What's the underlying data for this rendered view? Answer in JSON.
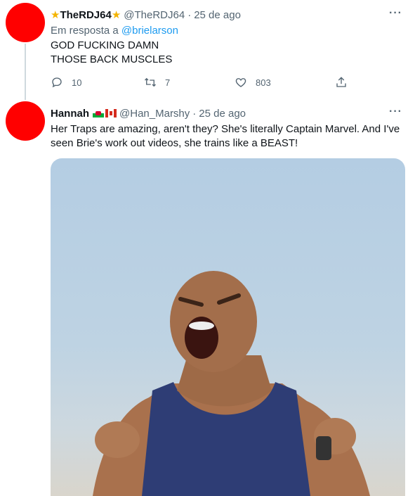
{
  "tweets": [
    {
      "name": "TheRDJ64",
      "handle": "@TheRDJ64",
      "separator": "·",
      "date": "25 de ago",
      "reply_prefix": "Em resposta a",
      "reply_to": "@brielarson",
      "text_lines": [
        "GOD FUCKING DAMN",
        "THOSE BACK MUSCLES"
      ],
      "reply_count": "10",
      "retweet_count": "7",
      "like_count": "803",
      "more_label": "···"
    },
    {
      "name": "Hannah",
      "handle": "@Han_Marshy",
      "separator": "·",
      "date": "25 de ago",
      "text": "Her Traps are amazing, aren't they? She's literally Captain Marvel. And I've seen Brie's work out videos, she trains like a BEAST!",
      "more_label": "···"
    }
  ],
  "colors": {
    "accent": "#1d9bf0",
    "muted": "#536471",
    "avatar": "#ff0000",
    "star": "#f4b400"
  },
  "icons": [
    "star-icon",
    "reply-icon",
    "retweet-icon",
    "like-icon",
    "share-icon",
    "more-icon",
    "wales-flag-icon",
    "canada-flag-icon"
  ]
}
